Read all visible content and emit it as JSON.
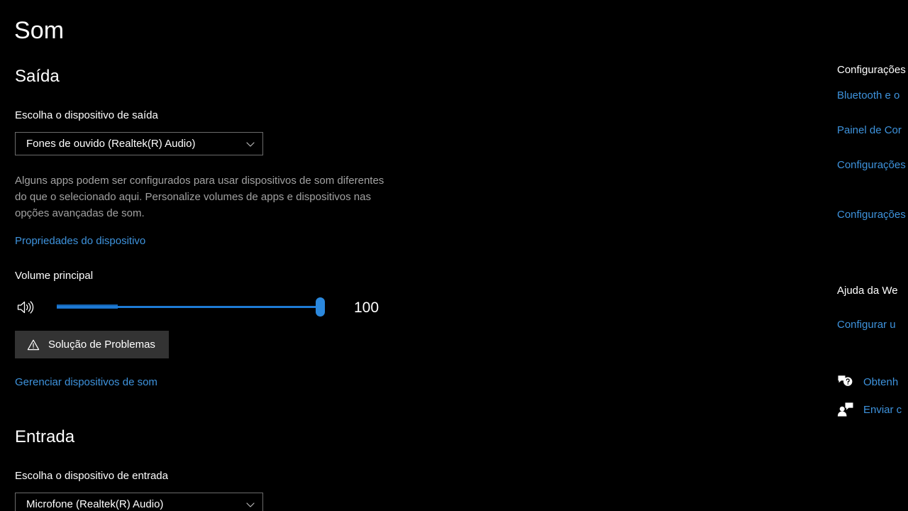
{
  "page": {
    "title": "Som"
  },
  "output": {
    "heading": "Saída",
    "device_label": "Escolha o dispositivo de saída",
    "device_value": "Fones de ouvido (Realtek(R) Audio)",
    "description": "Alguns apps podem ser configurados para usar dispositivos de som diferentes do que o selecionado aqui. Personalize volumes de apps e dispositivos nas opções avançadas de som.",
    "properties_link": "Propriedades do dispositivo",
    "volume_label": "Volume principal",
    "volume_value": "100",
    "troubleshoot_label": "Solução de Problemas",
    "manage_devices_link": "Gerenciar dispositivos de som"
  },
  "input": {
    "heading": "Entrada",
    "device_label": "Escolha o dispositivo de entrada",
    "device_value": "Microfone (Realtek(R) Audio)"
  },
  "sidebar": {
    "related_settings_heading": "Configurações",
    "links": [
      "Bluetooth e o",
      "Painel de Cor",
      "Configurações microfone",
      "Configurações de Acesso",
      "Configurar u"
    ],
    "web_help_heading": "Ajuda da We",
    "actions": [
      {
        "label": "Obtenh",
        "icon": "help-bubble-icon"
      },
      {
        "label": "Enviar c",
        "icon": "feedback-person-icon"
      }
    ]
  },
  "icons": {
    "speaker": "speaker-volume-icon",
    "warning": "warning-triangle-icon",
    "chevron": "chevron-down-icon"
  },
  "colors": {
    "background": "#000000",
    "link": "#3e93dd",
    "accent": "#2b88dd",
    "button": "#333333",
    "muted_text": "#a2a2a2"
  }
}
